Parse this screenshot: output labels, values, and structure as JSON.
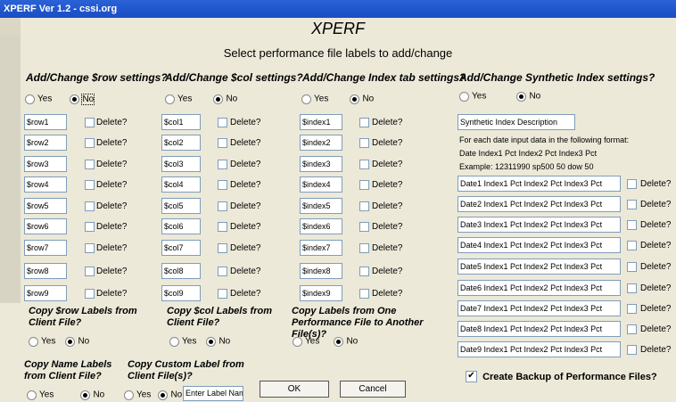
{
  "window": {
    "title": "XPERF Ver 1.2 - cssi.org"
  },
  "header": {
    "title": "XPERF",
    "subtitle": "Select performance file labels to add/change"
  },
  "sections": {
    "row": {
      "heading": "Add/Change $row settings?",
      "yes": "Yes",
      "no": "No",
      "selected": "No",
      "fields": [
        "$row1",
        "$row2",
        "$row3",
        "$row4",
        "$row5",
        "$row6",
        "$row7",
        "$row8",
        "$row9"
      ]
    },
    "col": {
      "heading": "Add/Change $col settings?",
      "yes": "Yes",
      "no": "No",
      "selected": "No",
      "fields": [
        "$col1",
        "$col2",
        "$col3",
        "$col4",
        "$col5",
        "$col6",
        "$col7",
        "$col8",
        "$col9"
      ]
    },
    "index": {
      "heading": "Add/Change Index tab settings?",
      "yes": "Yes",
      "no": "No",
      "selected": "No",
      "fields": [
        "$index1",
        "$index2",
        "$index3",
        "$index4",
        "$index5",
        "$index6",
        "$index7",
        "$index8",
        "$index9"
      ]
    },
    "synthetic": {
      "heading": "Add/Change Synthetic Index settings?",
      "yes": "Yes",
      "no": "No",
      "selected": "No",
      "description_value": "Synthetic Index Description",
      "info": [
        "For each date input data in the following format:",
        "Date Index1 Pct Index2 Pct Index3 Pct",
        "Example:  12311990 sp500 50 dow 50"
      ],
      "fields": [
        "Date1 Index1 Pct Index2 Pct Index3 Pct",
        "Date2 Index1 Pct Index2 Pct Index3 Pct",
        "Date3 Index1 Pct Index2 Pct Index3 Pct",
        "Date4 Index1 Pct Index2 Pct Index3 Pct",
        "Date5 Index1 Pct Index2 Pct Index3 Pct",
        "Date6 Index1 Pct Index2 Pct Index3 Pct",
        "Date7 Index1 Pct Index2 Pct Index3 Pct",
        "Date8 Index1 Pct Index2 Pct Index3 Pct",
        "Date9 Index1 Pct Index2 Pct Index3 Pct"
      ]
    }
  },
  "delete_label": "Delete?",
  "copy": {
    "row": {
      "label": "Copy $row Labels from Client File?",
      "yes": "Yes",
      "no": "No"
    },
    "col": {
      "label": "Copy $col Labels from Client File?",
      "yes": "Yes",
      "no": "No"
    },
    "perf": {
      "label": "Copy Labels from One Performance File to Another File(s)?",
      "yes": "Yes",
      "no": "No"
    },
    "name": {
      "label": "Copy Name Labels from Client File?",
      "yes": "Yes",
      "no": "No"
    },
    "custom": {
      "label": "Copy Custom Label from Client File(s)?",
      "yes": "Yes",
      "no": "No",
      "input_placeholder": "Enter Label Name"
    }
  },
  "buttons": {
    "ok": "OK",
    "cancel": "Cancel"
  },
  "backup": {
    "label": "Create Backup of Performance Files?",
    "checked": true
  }
}
